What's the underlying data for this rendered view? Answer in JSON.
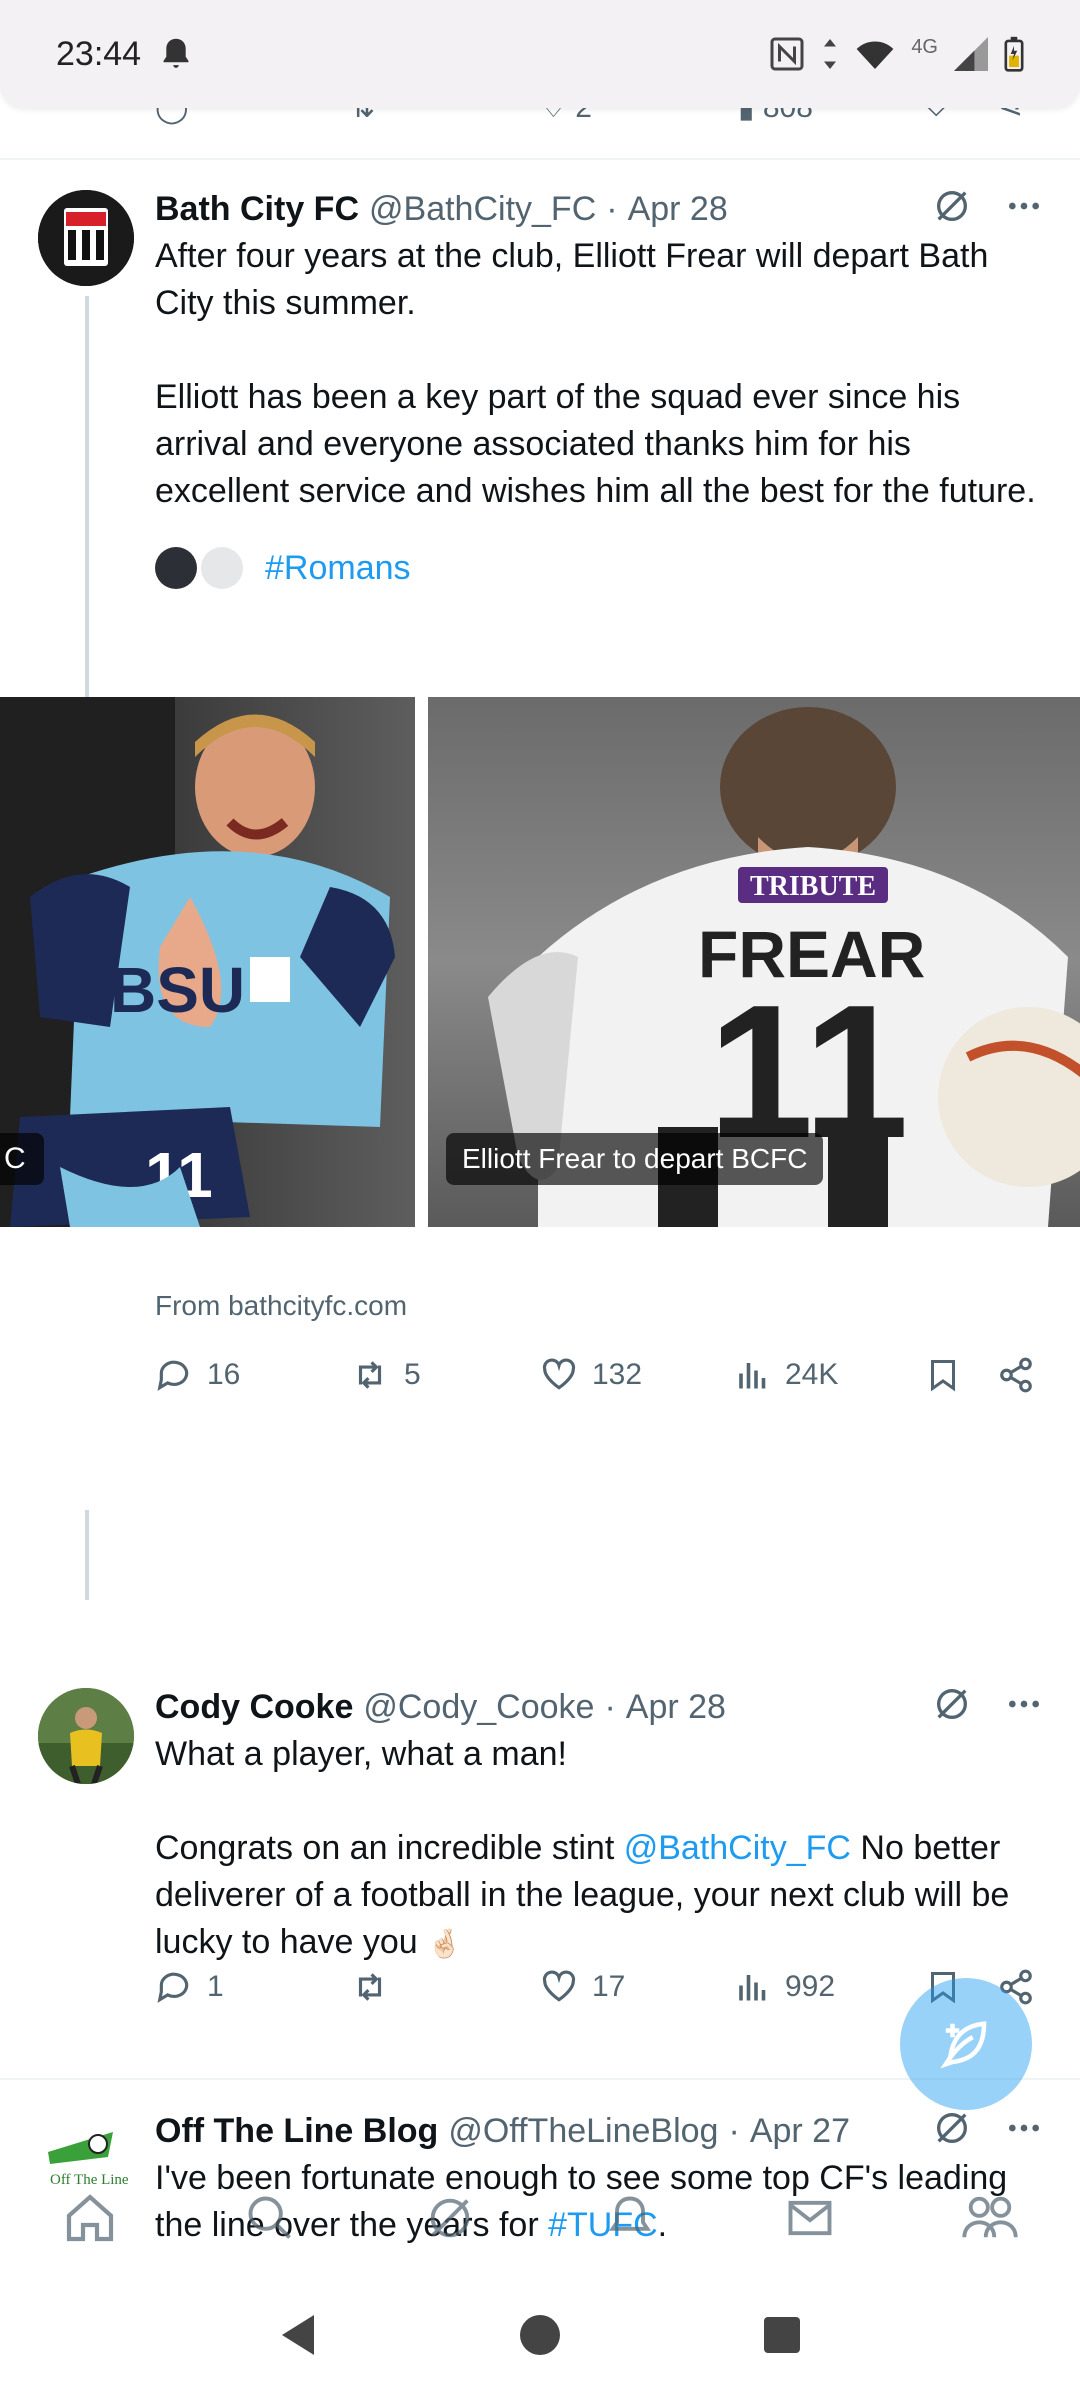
{
  "status": {
    "time": "23:44",
    "network": "4G"
  },
  "partial_row": {
    "likes": "2",
    "views": "808"
  },
  "tweet1": {
    "name": "Bath City FC",
    "handle": "@BathCity_FC",
    "date": "Apr 28",
    "paragraph1": "After four years at the club, Elliott Frear will depart Bath City this summer.",
    "paragraph2": "Elliott has been a key part of the squad ever since his arrival and everyone associated thanks him for his excellent service and wishes him all the best for the future.",
    "hashtag": "#Romans",
    "card_caption": "Elliott Frear to depart BCFC",
    "card_left_tag": "C",
    "shirt_sponsor_left": "BSU",
    "shirt_sponsor_right": "TRIBUTE",
    "shirt_name": "FREAR",
    "shirt_number": "11",
    "source": "From bathcityfc.com",
    "replies": "16",
    "reposts": "5",
    "likes": "132",
    "views": "24K"
  },
  "tweet2": {
    "name": "Cody Cooke",
    "handle": "@Cody_Cooke",
    "date": "Apr 28",
    "line1": "What a player, what a man!",
    "line2_before": "Congrats on an incredible stint ",
    "mention": "@BathCity_FC",
    "line2_after": " No better deliverer of a football in the league, your next club will be lucky to have you ",
    "emoji": "🤞🏻",
    "replies": "1",
    "reposts": "",
    "likes": "17",
    "views": "992"
  },
  "tweet3": {
    "name": "Off The Line Blog",
    "handle": "@OffTheLineBlog",
    "date": "Apr 27",
    "text_before": "I've been fortunate enough to see some top CF's leading the line over the years for ",
    "hashtag": "#TUFC",
    "text_after": ".",
    "avatar_label": "Off The Line"
  },
  "colors": {
    "accent": "#1d9bf0",
    "muted": "#536471",
    "text": "#0f1419"
  }
}
